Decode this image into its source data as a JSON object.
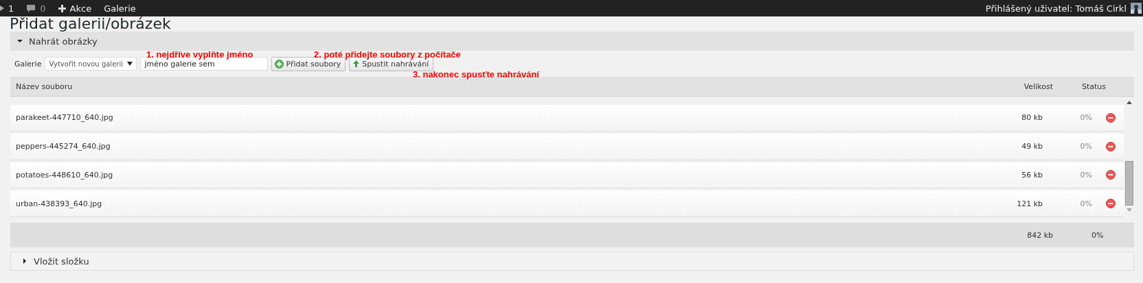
{
  "top_bar": {
    "items": [
      {
        "kind": "notice",
        "label": "1"
      },
      {
        "kind": "comments",
        "label": "0"
      },
      {
        "kind": "new",
        "label": "Akce"
      },
      {
        "kind": "link",
        "label": "Galerie"
      }
    ],
    "user": "Přihlášený uživatel: Tomáš Cirkl"
  },
  "page_title": "Přidat galerii/obrázek",
  "upload_panel": {
    "title": "Nahrát obrázky",
    "expanded": true,
    "gallery_label": "Galerie",
    "gallery_select": "Vytvořit novou galerii",
    "name_field": {
      "value": "jméno galerie sem"
    },
    "buttons": [
      {
        "kind": "add",
        "label": "Přidat soubory"
      },
      {
        "kind": "start",
        "label": "Spustit nahrávání"
      }
    ],
    "hints": [
      "1. nejdříve vyplňte jméno",
      "2. poté přidejte soubory z počítače",
      "3. nakonec spusťte nahrávání"
    ]
  },
  "table": {
    "columns": [
      "Název souboru",
      "Velikost",
      "Status"
    ],
    "rows": [
      {
        "name": "parakeet-447710_640.jpg",
        "size": "80 kb",
        "status": "0%"
      },
      {
        "name": "peppers-445274_640.jpg",
        "size": "49 kb",
        "status": "0%"
      },
      {
        "name": "potatoes-448610_640.jpg",
        "size": "56 kb",
        "status": "0%"
      },
      {
        "name": "urban-438393_640.jpg",
        "size": "121 kb",
        "status": "0%"
      }
    ],
    "footer": {
      "size": "842 kb",
      "status": "0%"
    }
  },
  "folder_panel": {
    "title": "Vložit složku",
    "expanded": false
  }
}
